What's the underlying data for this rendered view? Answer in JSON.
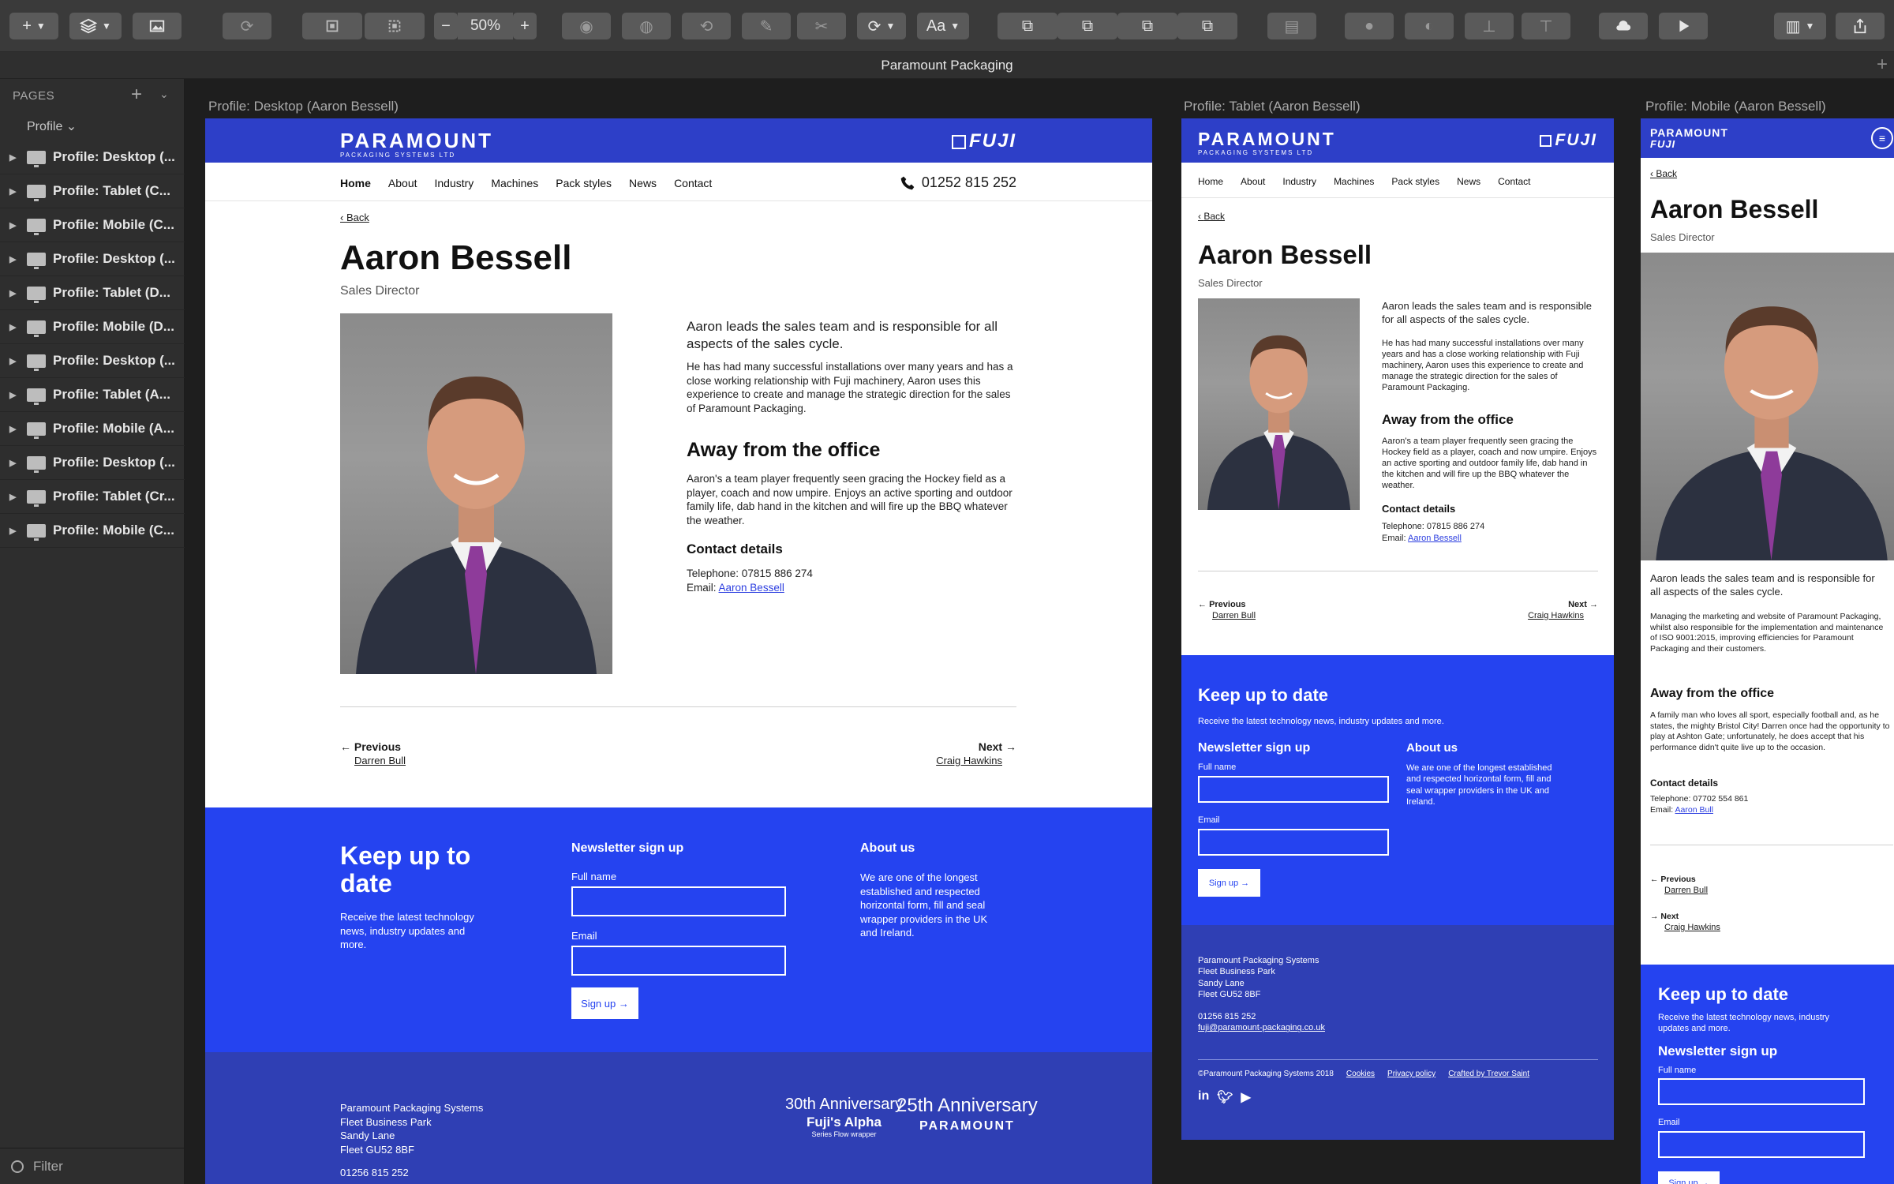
{
  "app": {
    "document_title": "Paramount Packaging",
    "zoom": "50%",
    "font_menu": "Aa"
  },
  "sidebar": {
    "heading": "PAGES",
    "page": "Profile",
    "artboards": [
      "Profile: Desktop (...",
      "Profile: Tablet (C...",
      "Profile: Mobile (C...",
      "Profile: Desktop (...",
      "Profile: Tablet (D...",
      "Profile: Mobile (D...",
      "Profile: Desktop (...",
      "Profile: Tablet (A...",
      "Profile: Mobile (A...",
      "Profile: Desktop (...",
      "Profile: Tablet (Cr...",
      "Profile: Mobile (C..."
    ],
    "filter": "Filter"
  },
  "artboards": {
    "desktop_label": "Profile: Desktop (Aaron Bessell)",
    "tablet_label": "Profile: Tablet (Aaron Bessell)",
    "mobile_label": "Profile: Mobile (Aaron Bessell)"
  },
  "site": {
    "logo": "PARAMOUNT",
    "logo_sub": "PACKAGING SYSTEMS LTD",
    "fuji": "FUJI",
    "nav": [
      "Home",
      "About",
      "Industry",
      "Machines",
      "Pack styles",
      "News",
      "Contact"
    ],
    "phone": "01252 815 252",
    "back": "Back",
    "name": "Aaron Bessell",
    "role": "Sales Director",
    "intro": "Aaron leads the sales team and is responsible for all aspects of the sales cycle.",
    "body": "He has had many successful installations over many years and has a close working relationship with Fuji machinery, Aaron uses this experience to create and manage the strategic direction for the sales of Paramount Packaging.",
    "away_heading": "Away from the office",
    "away_body": "Aaron's a team player frequently seen gracing the Hockey field as a player, coach and now umpire. Enjoys an active sporting and outdoor family life, dab hand in the kitchen and will fire up the BBQ whatever the weather.",
    "contact_heading": "Contact details",
    "telephone": "Telephone: 07815 886 274",
    "email_prefix": "Email:",
    "email_link": "Aaron Bessell",
    "prev_label": "Previous",
    "prev_name": "Darren Bull",
    "next_label": "Next",
    "next_name": "Craig Hawkins",
    "keep_heading": "Keep up to date",
    "keep_body": "Receive the latest technology news, industry updates and more.",
    "newsletter_heading": "Newsletter sign up",
    "full_name": "Full name",
    "email": "Email",
    "signup": "Sign up",
    "about_heading": "About us",
    "about_body": "We are one of the longest established and respected horizontal form, fill and seal wrapper providers in the UK and Ireland.",
    "address": [
      "Paramount Packaging Systems",
      "Fleet Business Park",
      "Sandy Lane",
      "Fleet GU52 8BF"
    ],
    "footer_phone": "01256 815 252",
    "footer_email": "fuji@paramount-packaging.co.uk",
    "copyright": "©Paramount Packaging Systems 2018",
    "cookies": "Cookies",
    "privacy": "Privacy policy",
    "crafted": "Crafted by Trevor Saint",
    "anniv30": "30th Anniversary",
    "anniv30_sub": "Fuji's Alpha",
    "anniv30_sub2": "Series Flow wrapper",
    "anniv25": "25th Anniversary",
    "anniv25_sub": "PARAMOUNT"
  },
  "mobile": {
    "body": "Managing the marketing and website of Paramount Packaging, whilst also responsible for the implementation and maintenance of ISO 9001:2015, improving efficiencies for Paramount Packaging and their customers.",
    "away_body": "A family man who loves all sport, especially football and, as he states, the mighty Bristol City! Darren once had the opportunity to play at Ashton Gate; unfortunately, he does accept that his performance didn't quite live up to the occasion.",
    "telephone": "Telephone: 07702 554 861",
    "email_link": "Aaron Bull"
  },
  "colors": {
    "brand_blue": "#2d3fc8",
    "footer_blue": "#2543f0",
    "dark_blue": "#2f3fb4"
  }
}
